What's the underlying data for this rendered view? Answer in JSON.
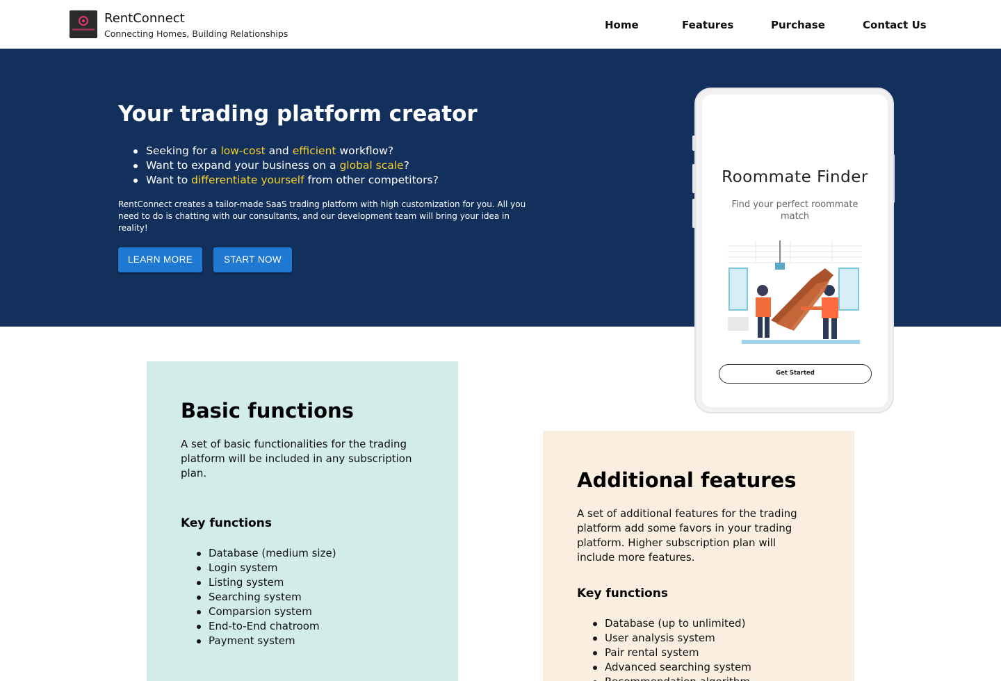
{
  "header": {
    "brand_name": "RentConnect",
    "tagline": "Connecting Homes, Building Relationships",
    "nav": [
      "Home",
      "Features",
      "Purchase",
      "Contact Us"
    ]
  },
  "hero": {
    "title": "Your trading platform creator",
    "bullets": [
      {
        "before": "Seeking for a ",
        "hl1": "low-cost",
        "mid": " and ",
        "hl2": "efficient",
        "after": " workflow?"
      },
      {
        "before": "Want to expand your business on a ",
        "hl1": "global scale",
        "after": "?"
      },
      {
        "before": "Want to ",
        "hl1": "differentiate yourself",
        "after": " from other competitors?"
      }
    ],
    "description": "RentConnect creates a tailor-made SaaS trading platform with high customization for you. All you need to do is chatting with our consultants, and our development team will bring your idea in reality!",
    "learn_more": "LEARN MORE",
    "start_now": "START NOW",
    "highlight_color": "#f5d12a",
    "background_color": "#13305c"
  },
  "phone": {
    "title": "Roommate Finder",
    "subtitle": "Find your perfect roommate match",
    "cta": "Get Started",
    "illustration_icon": "roommates-handshake-illustration"
  },
  "basic": {
    "title": "Basic functions",
    "description": "A set of basic functionalities for the trading platform will be included in any subscription plan.",
    "key_title": "Key functions",
    "items": [
      "Database (medium size)",
      "Login system",
      "Listing system",
      "Searching system",
      "Comparsion system",
      "End-to-End chatroom",
      "Payment system"
    ],
    "background_color": "#d2ecea"
  },
  "additional": {
    "title": "Additional features",
    "description": "A set of additional features for the trading platform add some favors in your trading platform. Higher subscription plan will include more features.",
    "key_title": "Key functions",
    "items": [
      "Database (up to unlimited)",
      "User analysis system",
      "Pair rental system",
      "Advanced searching system",
      "Recommendation algorithm"
    ],
    "background_color": "#faeee0"
  }
}
